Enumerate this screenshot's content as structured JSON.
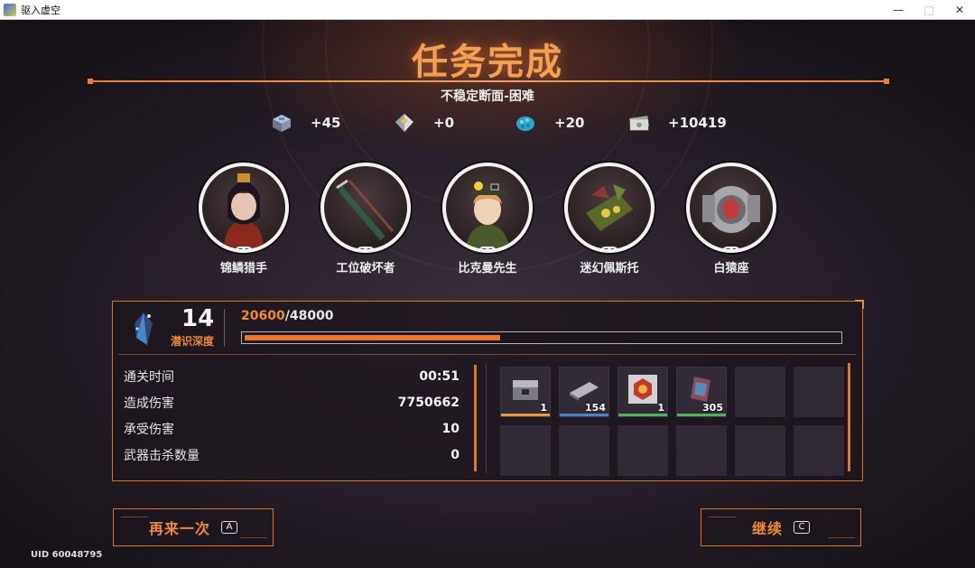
{
  "window": {
    "title": "驱入虚空",
    "min": "—",
    "max": "□",
    "close": "✕"
  },
  "heading": "任务完成",
  "subtitle": "不稳定断面-困难",
  "rewards": [
    {
      "icon": "cube-container-icon",
      "amount": "+45"
    },
    {
      "icon": "crystal-shard-icon",
      "amount": "+0"
    },
    {
      "icon": "blue-ore-icon",
      "amount": "+20"
    },
    {
      "icon": "credit-bills-icon",
      "amount": "+10419"
    }
  ],
  "team": [
    {
      "name": "锦鳞猎手",
      "level": "30"
    },
    {
      "name": "工位破坏者",
      "level": "30"
    },
    {
      "name": "比克曼先生",
      "level": "30"
    },
    {
      "name": "迷幻佩斯托",
      "level": "30"
    },
    {
      "name": "白猿座",
      "level": "30"
    }
  ],
  "depth": {
    "value": "14",
    "label": "潜识深度"
  },
  "exp": {
    "current": "20600",
    "separator": "/",
    "total": "48000",
    "progress": 0.43
  },
  "stats": [
    {
      "label": "通关时间",
      "value": "00:51"
    },
    {
      "label": "造成伤害",
      "value": "7750662"
    },
    {
      "label": "承受伤害",
      "value": "10"
    },
    {
      "label": "武器击杀数量",
      "value": "0"
    }
  ],
  "items": [
    {
      "icon": "supply-crate-icon",
      "count": "1",
      "rarity": "#e89a3c"
    },
    {
      "icon": "metal-plate-icon",
      "count": "154",
      "rarity": "#4f7fc9"
    },
    {
      "icon": "hexagon-emblem-icon",
      "count": "1",
      "rarity": "#4fb35a"
    },
    {
      "icon": "circuit-card-icon",
      "count": "305",
      "rarity": "#4fb35a"
    }
  ],
  "buttons": {
    "retry": {
      "label": "再来一次",
      "key": "A"
    },
    "continue": {
      "label": "继续",
      "key": "C"
    }
  },
  "uid": "UID 60048795",
  "colors": {
    "accent": "#f08a3a",
    "border": "#d8742c",
    "bar": "#ef7424"
  }
}
